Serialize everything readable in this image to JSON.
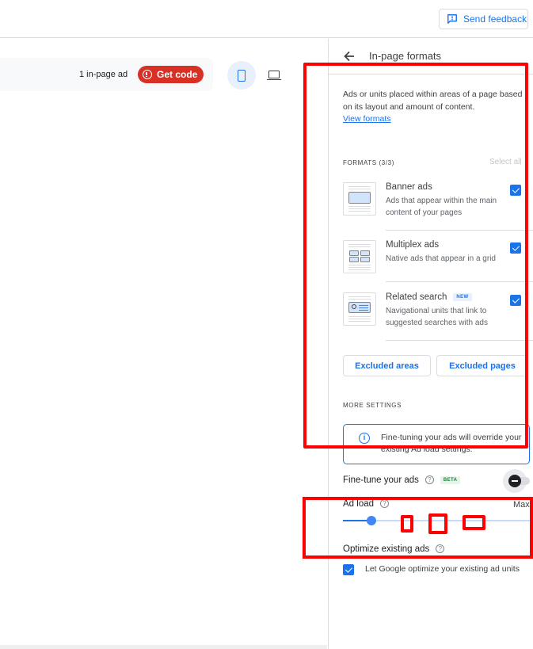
{
  "topbar": {
    "feedback_label": "Send feedback",
    "feedback_icon": "feedback-icon"
  },
  "preview": {
    "ad_count": "1 in-page ad",
    "get_code_label": "Get code",
    "get_code_icon": "alert-icon",
    "devices": [
      {
        "name": "mobile",
        "icon": "phone-icon",
        "selected": true
      },
      {
        "name": "desktop",
        "icon": "laptop-icon",
        "selected": false
      }
    ]
  },
  "panel": {
    "title": "In-page formats",
    "back_icon": "arrow-back-icon",
    "description": "Ads or units placed within areas of a page based on its layout and amount of content.",
    "view_formats_link": "View formats",
    "formats_label": "FORMATS (3/3)",
    "select_all_label": "Select all",
    "formats": [
      {
        "name": "Banner ads",
        "description": "Ads that appear within the main content of your pages",
        "checked": true,
        "badge": ""
      },
      {
        "name": "Multiplex ads",
        "description": "Native ads that appear in a grid",
        "checked": true,
        "badge": ""
      },
      {
        "name": "Related search",
        "description": "Navigational units that link to suggested searches with ads",
        "checked": true,
        "badge": "NEW"
      }
    ],
    "excluded_areas_label": "Excluded areas",
    "excluded_pages_label": "Excluded pages",
    "more_settings_label": "MORE SETTINGS",
    "info_text": "Fine-tuning your ads will override your existing Ad load settings.",
    "fine_tune_label": "Fine-tune your ads",
    "fine_tune_badge": "BETA",
    "fine_tune_enabled": false,
    "ad_load_label": "Ad load",
    "ad_load_max_label": "Max",
    "ad_load_value": 0.15,
    "optimize_label": "Optimize existing ads",
    "optimize_checkbox_label": "Let Google optimize your existing ad units",
    "optimize_checked": true
  },
  "colors": {
    "accent": "#1a73e8",
    "danger": "#d93025",
    "annotation": "#ff0000"
  }
}
